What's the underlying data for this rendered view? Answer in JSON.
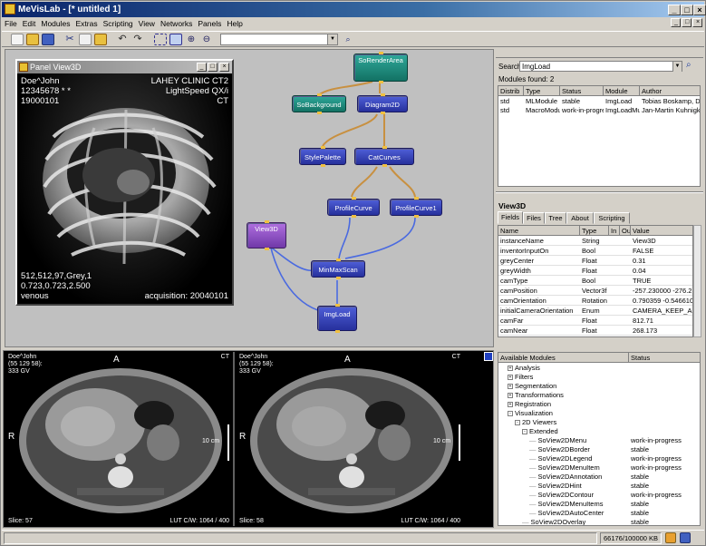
{
  "window": {
    "title": "MeVisLab - [* untitled 1]"
  },
  "menu": {
    "items": [
      "File",
      "Edit",
      "Modules",
      "Extras",
      "Scripting",
      "View",
      "Networks",
      "Panels",
      "Help"
    ]
  },
  "toolbar": {
    "combo_value": ""
  },
  "network": {
    "nodes": {
      "so_render_area": "SoRenderArea",
      "so_background": "SoBackground",
      "diagram2d": "Diagram2D",
      "style_palette": "StylePalette",
      "cat_curves": "CatCurves",
      "profile_curve": "ProfileCurve",
      "profile_curve1": "ProfileCurve1",
      "view3d": "View3D",
      "minmaxscan": "MinMaxScan",
      "imgload": "ImgLoad"
    }
  },
  "panel_view3d": {
    "title": "Panel View3D",
    "top_left": [
      "Doe^John",
      "12345678 * *",
      "19000101"
    ],
    "top_right": [
      "LAHEY CLINIC CT2",
      "LightSpeed QX/i",
      "CT"
    ],
    "bottom_left": [
      "512,512,97,Grey,1",
      "0.723,0.723,2.500",
      "venous"
    ],
    "bottom_right": "acquisition: 20040101"
  },
  "search": {
    "label": "Search",
    "value": "ImgLoad",
    "found_label": "Modules found: 2",
    "columns": [
      "Distrib",
      "Type",
      "Status",
      "Module",
      "Author"
    ],
    "rows": [
      [
        "std",
        "MLModule",
        "stable",
        "ImgLoad",
        "Tobias Boskamp, Dirk"
      ],
      [
        "std",
        "MacroModule",
        "work-in-progress",
        "ImgLoadMulti",
        "Jan-Martin Kuhnigk"
      ]
    ]
  },
  "inspector": {
    "title": "View3D",
    "tabs": [
      "Fields",
      "Files",
      "Tree",
      "About",
      "Scripting"
    ],
    "columns": [
      "Name",
      "Type",
      "In",
      "Ou",
      "Value"
    ],
    "rows": [
      [
        "instanceName",
        "String",
        "",
        "",
        "View3D"
      ],
      [
        "inventorInputOn",
        "Bool",
        "",
        "",
        "FALSE"
      ],
      [
        "greyCenter",
        "Float",
        "",
        "",
        "0.31"
      ],
      [
        "greyWidth",
        "Float",
        "",
        "",
        "0.04"
      ],
      [
        "camType",
        "Bool",
        "",
        "",
        "TRUE"
      ],
      [
        "camPosition",
        "Vector3f",
        "",
        "",
        "-257.230000 -276.2..."
      ],
      [
        "camOrientation",
        "Rotation",
        "",
        "",
        "0.790359 -0.546610..."
      ],
      [
        "initialCameraOrientation",
        "Enum",
        "",
        "",
        "CAMERA_KEEP_A..."
      ],
      [
        "camFar",
        "Float",
        "",
        "",
        "812.71"
      ],
      [
        "camNear",
        "Float",
        "",
        "",
        "268.173"
      ]
    ]
  },
  "viewers": {
    "left": {
      "patient": "Doe^John",
      "coords": "(55 129 58):",
      "value": "333 GV",
      "modality": "CT",
      "orient_top": "A",
      "orient_left": "R",
      "scale": "10 cm",
      "slice": "Slice: 57",
      "lut": "LUT C/W: 1064 / 400"
    },
    "right": {
      "patient": "Doe^John",
      "coords": "(55 129 58):",
      "value": "333 GV",
      "modality": "CT",
      "orient_top": "A",
      "orient_left": "R",
      "scale": "10 cm",
      "slice": "Slice: 58",
      "lut": "LUT C/W: 1064 / 400"
    }
  },
  "modules_tree": {
    "columns": [
      "Available Modules",
      "Status"
    ],
    "items": [
      {
        "label": "Analysis",
        "status": "",
        "indent": 1,
        "sign": "+"
      },
      {
        "label": "Filters",
        "status": "",
        "indent": 1,
        "sign": "+"
      },
      {
        "label": "Segmentation",
        "status": "",
        "indent": 1,
        "sign": "+"
      },
      {
        "label": "Transformations",
        "status": "",
        "indent": 1,
        "sign": "+"
      },
      {
        "label": "Registration",
        "status": "",
        "indent": 1,
        "sign": "+"
      },
      {
        "label": "Visualization",
        "status": "",
        "indent": 1,
        "sign": "-"
      },
      {
        "label": "2D Viewers",
        "status": "",
        "indent": 2,
        "sign": "-"
      },
      {
        "label": "Extended",
        "status": "",
        "indent": 3,
        "sign": "-"
      },
      {
        "label": "SoView2DMenu",
        "status": "work-in-progress",
        "indent": 4,
        "sign": ""
      },
      {
        "label": "SoView2DBorder",
        "status": "stable",
        "indent": 4,
        "sign": ""
      },
      {
        "label": "SoView2DLegend",
        "status": "work-in-progress",
        "indent": 4,
        "sign": ""
      },
      {
        "label": "SoView2DMenuItem",
        "status": "work-in-progress",
        "indent": 4,
        "sign": ""
      },
      {
        "label": "SoView2DAnnotation",
        "status": "stable",
        "indent": 4,
        "sign": ""
      },
      {
        "label": "SoView2DHint",
        "status": "stable",
        "indent": 4,
        "sign": ""
      },
      {
        "label": "SoView2DContour",
        "status": "work-in-progress",
        "indent": 4,
        "sign": ""
      },
      {
        "label": "SoView2DMenuItems",
        "status": "stable",
        "indent": 4,
        "sign": ""
      },
      {
        "label": "SoView2DAutoCenter",
        "status": "stable",
        "indent": 4,
        "sign": ""
      },
      {
        "label": "SoView2DOverlay",
        "status": "stable",
        "indent": 3,
        "sign": ""
      }
    ]
  },
  "statusbar": {
    "memory": "66176/100000 KB"
  },
  "colors": {
    "titlebar": "#0a246a",
    "node_blue": "#2f3aa8",
    "node_teal": "#1a8a7a",
    "node_purple": "#8a48c0",
    "wire_orange": "#c89040",
    "wire_blue": "#4a6ae0"
  }
}
